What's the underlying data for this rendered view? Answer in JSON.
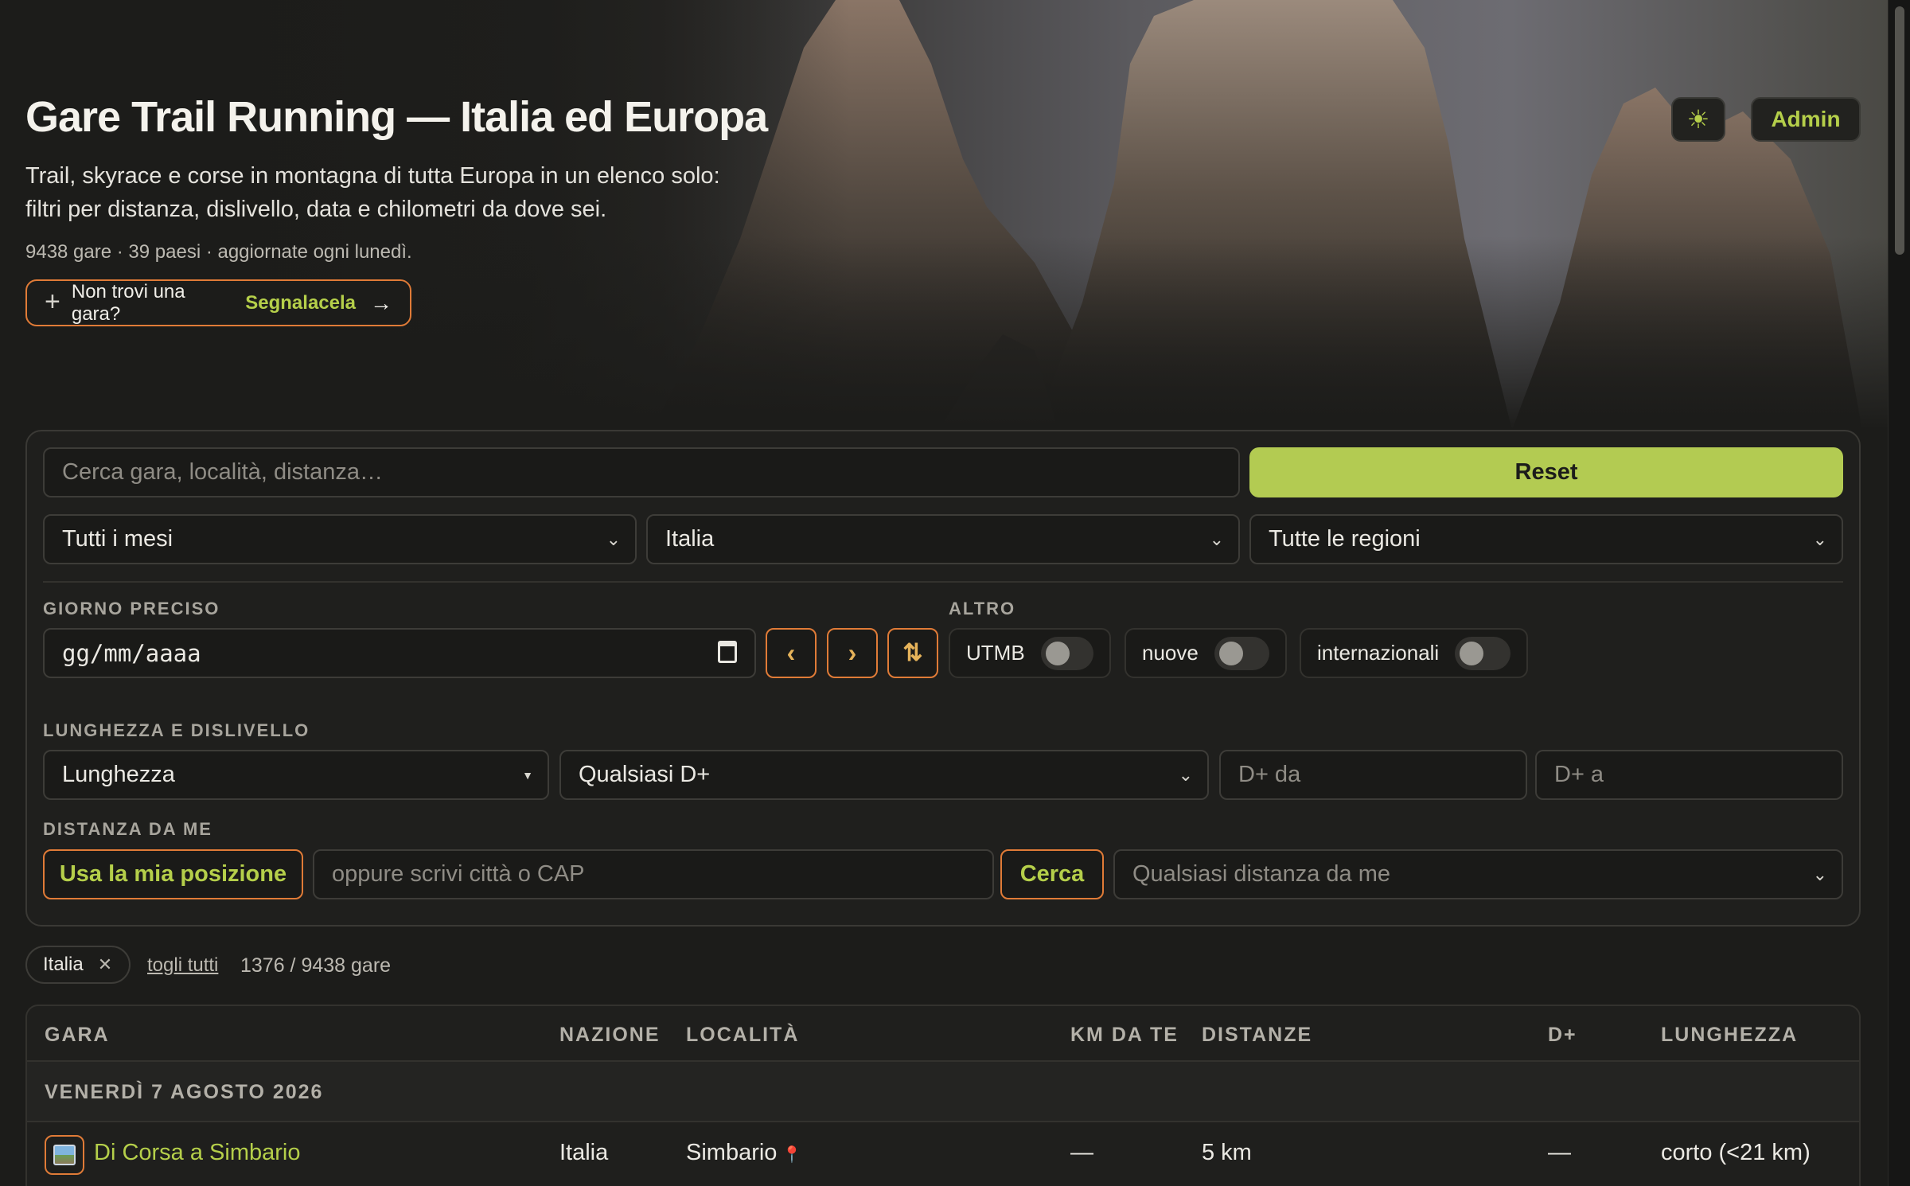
{
  "header": {
    "title": "Gare Trail Running — Italia ed Europa",
    "subtitle_line1": "Trail, skyrace e corse in montagna di tutta Europa in un elenco solo:",
    "subtitle_line2": "filtri per distanza, dislivello, data e chilometri da dove sei.",
    "meta": "9438 gare · 39 paesi · aggiornate ogni lunedì.",
    "suggest_prefix": "Non trovi una gara?",
    "suggest_link": "Segnalacela",
    "suggest_arrow": "→",
    "admin_label": "Admin",
    "theme_icon": "☀"
  },
  "filters": {
    "search_placeholder": "Cerca gara, località, distanza…",
    "reset_label": "Reset",
    "month_select": "Tutti i mesi",
    "country_select": "Italia",
    "region_select": "Tutte le regioni",
    "date_section_label": "GIORNO PRECISO",
    "date_placeholder": "gg/mm/aaaa",
    "prev_label": "‹",
    "next_label": "›",
    "swap_label": "⇅",
    "other_section_label": "ALTRO",
    "toggles": [
      {
        "label": "UTMB",
        "on": false
      },
      {
        "label": "nuove",
        "on": false
      },
      {
        "label": "internazionali",
        "on": false
      }
    ],
    "length_section_label": "LUNGHEZZA E DISLIVELLO",
    "length_select": "Lunghezza",
    "elevation_select": "Qualsiasi D+",
    "elevation_from_placeholder": "D+ da",
    "elevation_to_placeholder": "D+ a",
    "distance_section_label": "DISTANZA DA ME",
    "use_position_label": "Usa la mia posizione",
    "city_placeholder": "oppure scrivi città o CAP",
    "search_button_label": "Cerca",
    "distance_select": "Qualsiasi distanza da me"
  },
  "active_filters": {
    "chips": [
      {
        "label": "Italia",
        "remove": "✕"
      }
    ],
    "clear_all_label": "togli tutti",
    "count_text": "1376 / 9438 gare"
  },
  "table": {
    "columns": [
      "GARA",
      "NAZIONE",
      "LOCALITÀ",
      "KM DA TE",
      "DISTANZE",
      "D+",
      "LUNGHEZZA"
    ],
    "groups": [
      {
        "date_label": "VENERDÌ 7 AGOSTO 2026",
        "rows": [
          {
            "name": "Di Corsa a Simbario",
            "country": "Italia",
            "location": "Simbario",
            "km_from_you": "—",
            "distances": "5 km",
            "elevation": "—",
            "length": "corto (<21 km)"
          }
        ]
      }
    ]
  },
  "colors": {
    "accent_green": "#b5cf4a",
    "accent_orange": "#e07b37",
    "background": "#1c1c1a"
  }
}
